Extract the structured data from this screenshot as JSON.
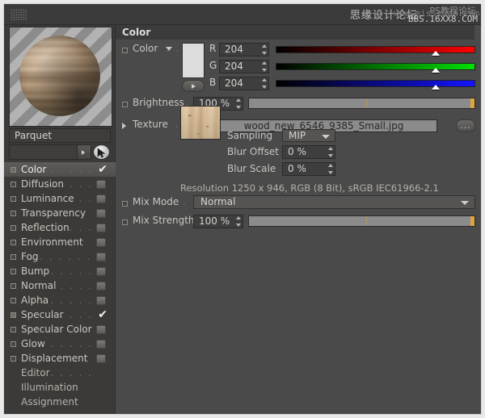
{
  "window": {
    "grip_icon": "dotted-grip-icon"
  },
  "watermark": {
    "cn_text": "思缘设计论坛",
    "url_text": "www.missyuan.com",
    "top_text": "PS教程论坛",
    "bottom_text": "BBS.16XX8.COM"
  },
  "sidebar": {
    "preview_name": "material-preview-sphere",
    "material_name": "Parquet",
    "cursor_icon": "arrow-cursor-icon",
    "channels": [
      {
        "label": "Color",
        "dots": ". . . . . . . .",
        "checked": true,
        "selected": true,
        "has_box": false
      },
      {
        "label": "Diffusion",
        "dots": ". . . . . . .",
        "checked": false,
        "selected": false,
        "has_box": true
      },
      {
        "label": "Luminance",
        "dots": ". . . . .",
        "checked": false,
        "selected": false,
        "has_box": true
      },
      {
        "label": "Transparency",
        "dots": "",
        "checked": false,
        "selected": false,
        "has_box": true
      },
      {
        "label": "Reflection",
        "dots": ". . . .",
        "checked": false,
        "selected": false,
        "has_box": true
      },
      {
        "label": "Environment",
        "dots": "",
        "checked": false,
        "selected": false,
        "has_box": true
      },
      {
        "label": "Fog",
        "dots": ". . . . . . . . .",
        "checked": false,
        "selected": false,
        "has_box": true
      },
      {
        "label": "Bump",
        "dots": ". . . . . . . .",
        "checked": false,
        "selected": false,
        "has_box": true
      },
      {
        "label": "Normal",
        "dots": ". . . . . .",
        "checked": false,
        "selected": false,
        "has_box": true
      },
      {
        "label": "Alpha",
        "dots": ". . . . . . .",
        "checked": false,
        "selected": false,
        "has_box": true
      },
      {
        "label": "Specular",
        "dots": ". . . . .",
        "checked": true,
        "selected": false,
        "has_box": false
      },
      {
        "label": "Specular Color",
        "dots": "",
        "checked": false,
        "selected": false,
        "has_box": true
      },
      {
        "label": "Glow",
        "dots": ". . . . . . . .",
        "checked": false,
        "selected": false,
        "has_box": true
      },
      {
        "label": "Displacement",
        "dots": "",
        "checked": false,
        "selected": false,
        "has_box": true
      }
    ],
    "pages": [
      {
        "label": "Editor",
        "dots": ". . . . . . ."
      },
      {
        "label": "Illumination",
        "dots": ""
      },
      {
        "label": "Assignment",
        "dots": ""
      }
    ]
  },
  "content": {
    "section_title": "Color",
    "color_row": {
      "label": "Color",
      "dots": ". . . .",
      "swatch_color": "#dcdcdc",
      "expand_icon": "triangle-down-icon",
      "channels": [
        {
          "name": "R",
          "value": "204",
          "slider_pct": 80
        },
        {
          "name": "G",
          "value": "204",
          "slider_pct": 80
        },
        {
          "name": "B",
          "value": "204",
          "slider_pct": 80
        }
      ]
    },
    "brightness_row": {
      "label": "Brightness",
      "dots": ".",
      "value": "100 %",
      "slider_pct": 100
    },
    "texture_row": {
      "label": "Texture",
      "dots": ". . . .",
      "expand_icon": "triangle-right-icon",
      "filename": "wood_new_6546_9385_Small.jpg",
      "browse_label": "...",
      "thumb_name": "texture-thumbnail-wood"
    },
    "sampling_row": {
      "label": "Sampling",
      "value": "MIP"
    },
    "blur_offset_row": {
      "label": "Blur Offset",
      "value": "0 %"
    },
    "blur_scale_row": {
      "label": "Blur Scale",
      "value": "0 %"
    },
    "resolution_text": "Resolution 1250 x 946, RGB (8 Bit), sRGB IEC61966-2.1",
    "mix_mode_row": {
      "label": "Mix Mode",
      "dots": ". .",
      "value": "Normal"
    },
    "mix_strength_row": {
      "label": "Mix Strength",
      "value": "100 %",
      "slider_pct": 100
    }
  }
}
